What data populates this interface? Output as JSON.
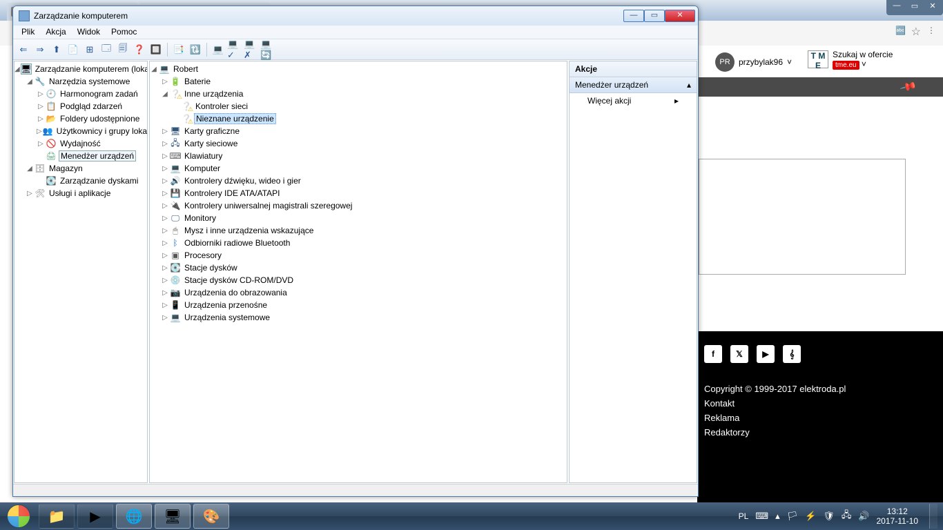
{
  "browser": {
    "tabs": [
      {
        "title": ""
      },
      {
        "title": ""
      }
    ],
    "win_min": "—",
    "win_max": "▭",
    "win_close": "✕",
    "addr_icons": {
      "translate": "🔤",
      "star": "☆",
      "menu": "⋮"
    },
    "user": {
      "initials": "PR",
      "name": "przybylak96",
      "chev": "˅"
    },
    "tme": {
      "logo_t1": "T M",
      "logo_t2": "E",
      "line1": "Szukaj w ofercie",
      "line2": "tme.eu",
      "chev": "˅"
    },
    "pin": "📌"
  },
  "footer": {
    "copy": "Copyright © 1999-2017 elektroda.pl",
    "links": [
      "Kontakt",
      "Reklama",
      "Redaktorzy"
    ],
    "social": [
      "f",
      "𝕏",
      "▶",
      "𝄞"
    ]
  },
  "win": {
    "title": "Zarządzanie komputerem",
    "wb": {
      "min": "—",
      "max": "▭",
      "close": "✕"
    },
    "menu": [
      "Plik",
      "Akcja",
      "Widok",
      "Pomoc"
    ],
    "toolbar": [
      "⇐",
      "⇒",
      "⬆",
      "📄",
      "⊞",
      "🗔",
      "🗐",
      "❓",
      "🔲",
      "|",
      "📑",
      "🔃",
      "|",
      "💻",
      "💻✓",
      "💻✗",
      "💻🔄"
    ]
  },
  "leftTree": [
    {
      "ind": 1,
      "tw": "◢",
      "ic": "🖥",
      "cls": "i-comp",
      "name": "root",
      "label": "Zarządzanie komputerem (lokalnym)"
    },
    {
      "ind": 2,
      "tw": "◢",
      "ic": "🔧",
      "cls": "i-tool",
      "name": "sys-tools",
      "label": "Narzędzia systemowe"
    },
    {
      "ind": 3,
      "tw": "▷",
      "ic": "🕘",
      "cls": "i-clock",
      "name": "scheduler",
      "label": "Harmonogram zadań"
    },
    {
      "ind": 3,
      "tw": "▷",
      "ic": "📋",
      "cls": "i-log",
      "name": "events",
      "label": "Podgląd zdarzeń"
    },
    {
      "ind": 3,
      "tw": "▷",
      "ic": "📂",
      "cls": "i-share",
      "name": "shares",
      "label": "Foldery udostępnione"
    },
    {
      "ind": 3,
      "tw": "▷",
      "ic": "👥",
      "cls": "i-users",
      "name": "users",
      "label": "Użytkownicy i grupy lokalne"
    },
    {
      "ind": 3,
      "tw": "▷",
      "ic": "🚫",
      "cls": "i-perf",
      "name": "perf",
      "label": "Wydajność"
    },
    {
      "ind": 3,
      "tw": "",
      "ic": "🖨",
      "cls": "i-dev",
      "name": "devmgr",
      "label": "Menedżer urządzeń",
      "sel": false,
      "hl": true
    },
    {
      "ind": 2,
      "tw": "◢",
      "ic": "🗄",
      "cls": "i-store",
      "name": "storage",
      "label": "Magazyn"
    },
    {
      "ind": 3,
      "tw": "",
      "ic": "💽",
      "cls": "i-disk",
      "name": "diskmgr",
      "label": "Zarządzanie dyskami"
    },
    {
      "ind": 2,
      "tw": "▷",
      "ic": "🛠",
      "cls": "i-srv",
      "name": "services",
      "label": "Usługi i aplikacje"
    }
  ],
  "midTree": [
    {
      "ind": 1,
      "tw": "◢",
      "ic": "💻",
      "cls": "",
      "name": "host",
      "label": "Robert"
    },
    {
      "ind": 2,
      "tw": "▷",
      "ic": "🔋",
      "cls": "i-bat",
      "name": "batt",
      "label": "Baterie"
    },
    {
      "ind": 2,
      "tw": "◢",
      "ic": "❔",
      "cls": "i-warn",
      "name": "other",
      "label": "Inne urządzenia"
    },
    {
      "ind": 3,
      "tw": "",
      "ic": "❔",
      "cls": "i-warn",
      "name": "netctrl",
      "label": "Kontroler sieci"
    },
    {
      "ind": 3,
      "tw": "",
      "ic": "❔",
      "cls": "i-warn",
      "name": "unknown",
      "label": "Nieznane urządzenie",
      "sel": true
    },
    {
      "ind": 2,
      "tw": "▷",
      "ic": "🖥",
      "cls": "i-gpu",
      "name": "gpu",
      "label": "Karty graficzne"
    },
    {
      "ind": 2,
      "tw": "▷",
      "ic": "🖧",
      "cls": "i-net",
      "name": "nic",
      "label": "Karty sieciowe"
    },
    {
      "ind": 2,
      "tw": "▷",
      "ic": "⌨",
      "cls": "i-kb",
      "name": "kbd",
      "label": "Klawiatury"
    },
    {
      "ind": 2,
      "tw": "▷",
      "ic": "💻",
      "cls": "i-pc",
      "name": "computer",
      "label": "Komputer"
    },
    {
      "ind": 2,
      "tw": "▷",
      "ic": "🔊",
      "cls": "i-snd",
      "name": "avctl",
      "label": "Kontrolery dźwięku, wideo i gier"
    },
    {
      "ind": 2,
      "tw": "▷",
      "ic": "💾",
      "cls": "i-ide",
      "name": "ide",
      "label": "Kontrolery IDE ATA/ATAPI"
    },
    {
      "ind": 2,
      "tw": "▷",
      "ic": "🔌",
      "cls": "i-usb",
      "name": "usb",
      "label": "Kontrolery uniwersalnej magistrali szeregowej"
    },
    {
      "ind": 2,
      "tw": "▷",
      "ic": "🖵",
      "cls": "i-mon",
      "name": "mon",
      "label": "Monitory"
    },
    {
      "ind": 2,
      "tw": "▷",
      "ic": "🖱",
      "cls": "i-mouse",
      "name": "mouse",
      "label": "Mysz i inne urządzenia wskazujące"
    },
    {
      "ind": 2,
      "tw": "▷",
      "ic": "ᛒ",
      "cls": "i-bt",
      "name": "bt",
      "label": "Odbiorniki radiowe Bluetooth"
    },
    {
      "ind": 2,
      "tw": "▷",
      "ic": "▣",
      "cls": "i-cpu",
      "name": "cpu",
      "label": "Procesory"
    },
    {
      "ind": 2,
      "tw": "▷",
      "ic": "💽",
      "cls": "i-hd",
      "name": "hd",
      "label": "Stacje dysków"
    },
    {
      "ind": 2,
      "tw": "▷",
      "ic": "💿",
      "cls": "i-cd",
      "name": "cd",
      "label": "Stacje dysków CD-ROM/DVD"
    },
    {
      "ind": 2,
      "tw": "▷",
      "ic": "📷",
      "cls": "i-img",
      "name": "imaging",
      "label": "Urządzenia do obrazowania"
    },
    {
      "ind": 2,
      "tw": "▷",
      "ic": "📱",
      "cls": "i-port",
      "name": "portable",
      "label": "Urządzenia przenośne"
    },
    {
      "ind": 2,
      "tw": "▷",
      "ic": "💻",
      "cls": "i-sys",
      "name": "sysdev",
      "label": "Urządzenia systemowe"
    }
  ],
  "actions": {
    "hdr": "Akcje",
    "section": "Menedżer urządzeń",
    "sec_arrow": "▴",
    "item": "Więcej akcji",
    "item_arrow": "▸"
  },
  "taskbar": {
    "btns": [
      {
        "name": "explorer",
        "glyph": "📁",
        "active": false
      },
      {
        "name": "wmplayer",
        "glyph": "▶",
        "active": false
      },
      {
        "name": "chrome",
        "glyph": "🌐",
        "active": true
      },
      {
        "name": "mmc",
        "glyph": "🖥",
        "active": true
      },
      {
        "name": "paint",
        "glyph": "🎨",
        "active": true
      }
    ],
    "lang": "PL",
    "tray": [
      "⌨",
      "▴",
      "🏳",
      "⚡",
      "🛡",
      "🖧",
      "🔊"
    ],
    "time": "13:12",
    "date": "2017-11-10"
  }
}
